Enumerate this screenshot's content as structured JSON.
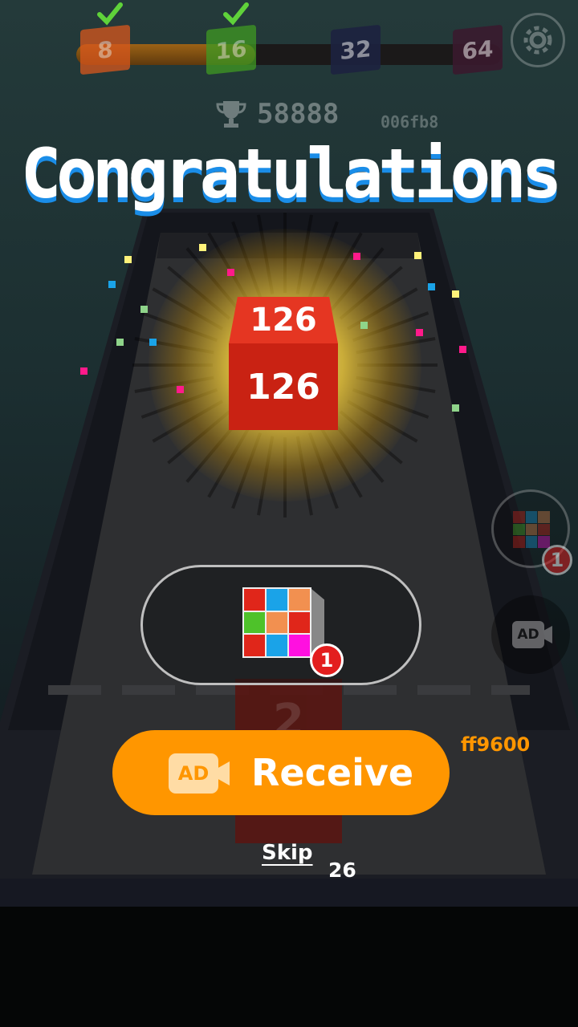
{
  "progress": {
    "milestones": [
      {
        "value": "8",
        "color": "#d9571c",
        "completed": true
      },
      {
        "value": "16",
        "color": "#3f9a22",
        "completed": true
      },
      {
        "value": "32",
        "color": "#1d2240",
        "completed": false
      },
      {
        "value": "64",
        "color": "#3a1a2e",
        "completed": false
      }
    ],
    "fill_fraction": 0.42,
    "fill_color": "#a8620e"
  },
  "score": {
    "value": "58888",
    "icon": "trophy-icon"
  },
  "hex_note": "006fb8",
  "headline": "Congratulations",
  "cube": {
    "top_value": "126",
    "front_value": "126",
    "color": "#c92213"
  },
  "reward": {
    "item": "rubik-cube",
    "count": "1"
  },
  "side_buttons": {
    "item_count": "1",
    "ad_label": "AD"
  },
  "receive": {
    "ad_label": "AD",
    "label": "Receive",
    "color": "#ff9600"
  },
  "color_note": "ff9600",
  "skip": {
    "label": "Skip",
    "countdown": "26"
  },
  "road_tile": {
    "value": "2"
  }
}
